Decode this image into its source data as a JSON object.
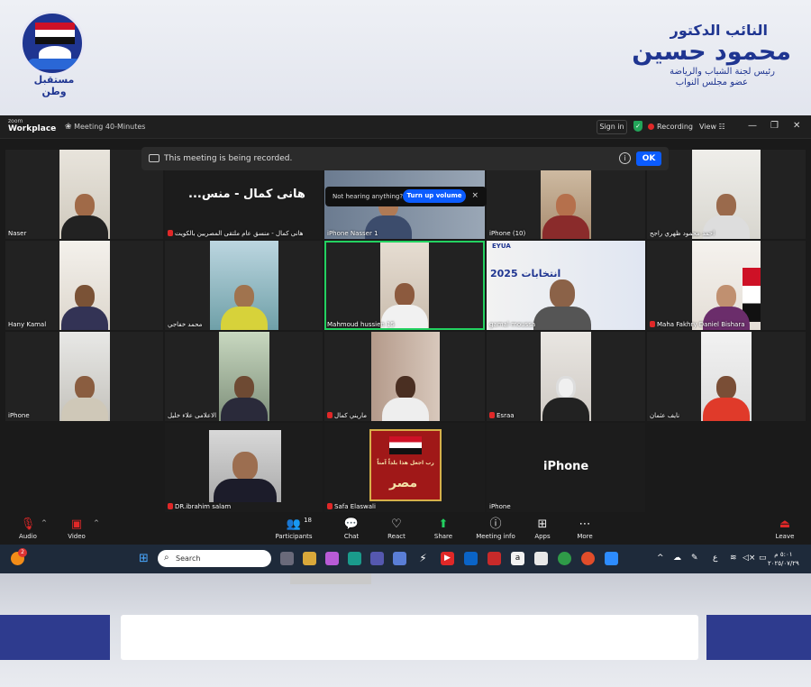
{
  "banner": {
    "logo_text": "مستقبل وطن",
    "title_line": "النائب الدكتور",
    "name_line": "محمود حسين",
    "subtitle_1": "رئيس لجنة الشباب والرياضة",
    "subtitle_2": "عضو مجلس النواب"
  },
  "zoom": {
    "logo_small": "zoom",
    "logo_big": "Workplace",
    "meeting_label": "Meeting 40-Minutes",
    "sign_in": "Sign in",
    "recording": "Recording",
    "view": "View",
    "recording_bar_text": "This meeting is being recorded.",
    "ok": "OK",
    "hearing_prompt": "Not hearing anything?",
    "turn_up_volume": "Turn up volume",
    "close": "×",
    "tiles": [
      {
        "name": "Naser",
        "muted": false
      },
      {
        "name": "هانى كمال - منسق عام ملتقى المصريين  بالكويت",
        "muted": true,
        "big": "...هانى كمال - منس"
      },
      {
        "name": "iPhone Nasser 1",
        "muted": false
      },
      {
        "name": "iPhone (10)",
        "muted": false
      },
      {
        "name": "احمد محمود ظهري راجح",
        "muted": false
      },
      {
        "name": "Hany Kamal",
        "muted": false
      },
      {
        "name": "محمد خفاجي",
        "muted": false
      },
      {
        "name": "Mahmoud hussien 15",
        "muted": false
      },
      {
        "name": "gamal moussa",
        "muted": false
      },
      {
        "name": "Maha  Fakhry Daniel Bishara",
        "muted": true
      },
      {
        "name": "iPhone",
        "muted": false
      },
      {
        "name": "الاعلامى علاء خليل",
        "muted": false
      },
      {
        "name": "ماريني كمال",
        "muted": true
      },
      {
        "name": "Esraa",
        "muted": true
      },
      {
        "name": "نايف عثمان",
        "muted": false
      },
      {
        "name": "DR.ibrahim salam",
        "muted": true
      },
      {
        "name": "Safa Elaswali",
        "muted": true
      },
      {
        "name": "iPhone",
        "muted": false,
        "big": "iPhone"
      }
    ],
    "poster_text": "رب اجعل هذا بلداً آمناً",
    "poster_word": "مصر",
    "slide_text": "انتخابات 2025",
    "slide_logo": "EYUA",
    "toolbar": {
      "audio": "Audio",
      "video": "Video",
      "participants": "Participants",
      "participants_count": "18",
      "chat": "Chat",
      "react": "React",
      "share": "Share",
      "meeting_info": "Meeting info",
      "apps": "Apps",
      "more": "More",
      "leave": "Leave"
    }
  },
  "taskbar": {
    "search_placeholder": "Search",
    "notif_count": "2",
    "lang": "ع",
    "time": "٥:٠١ م",
    "date": "٢٠٢٥/٠٧/٢٩"
  }
}
